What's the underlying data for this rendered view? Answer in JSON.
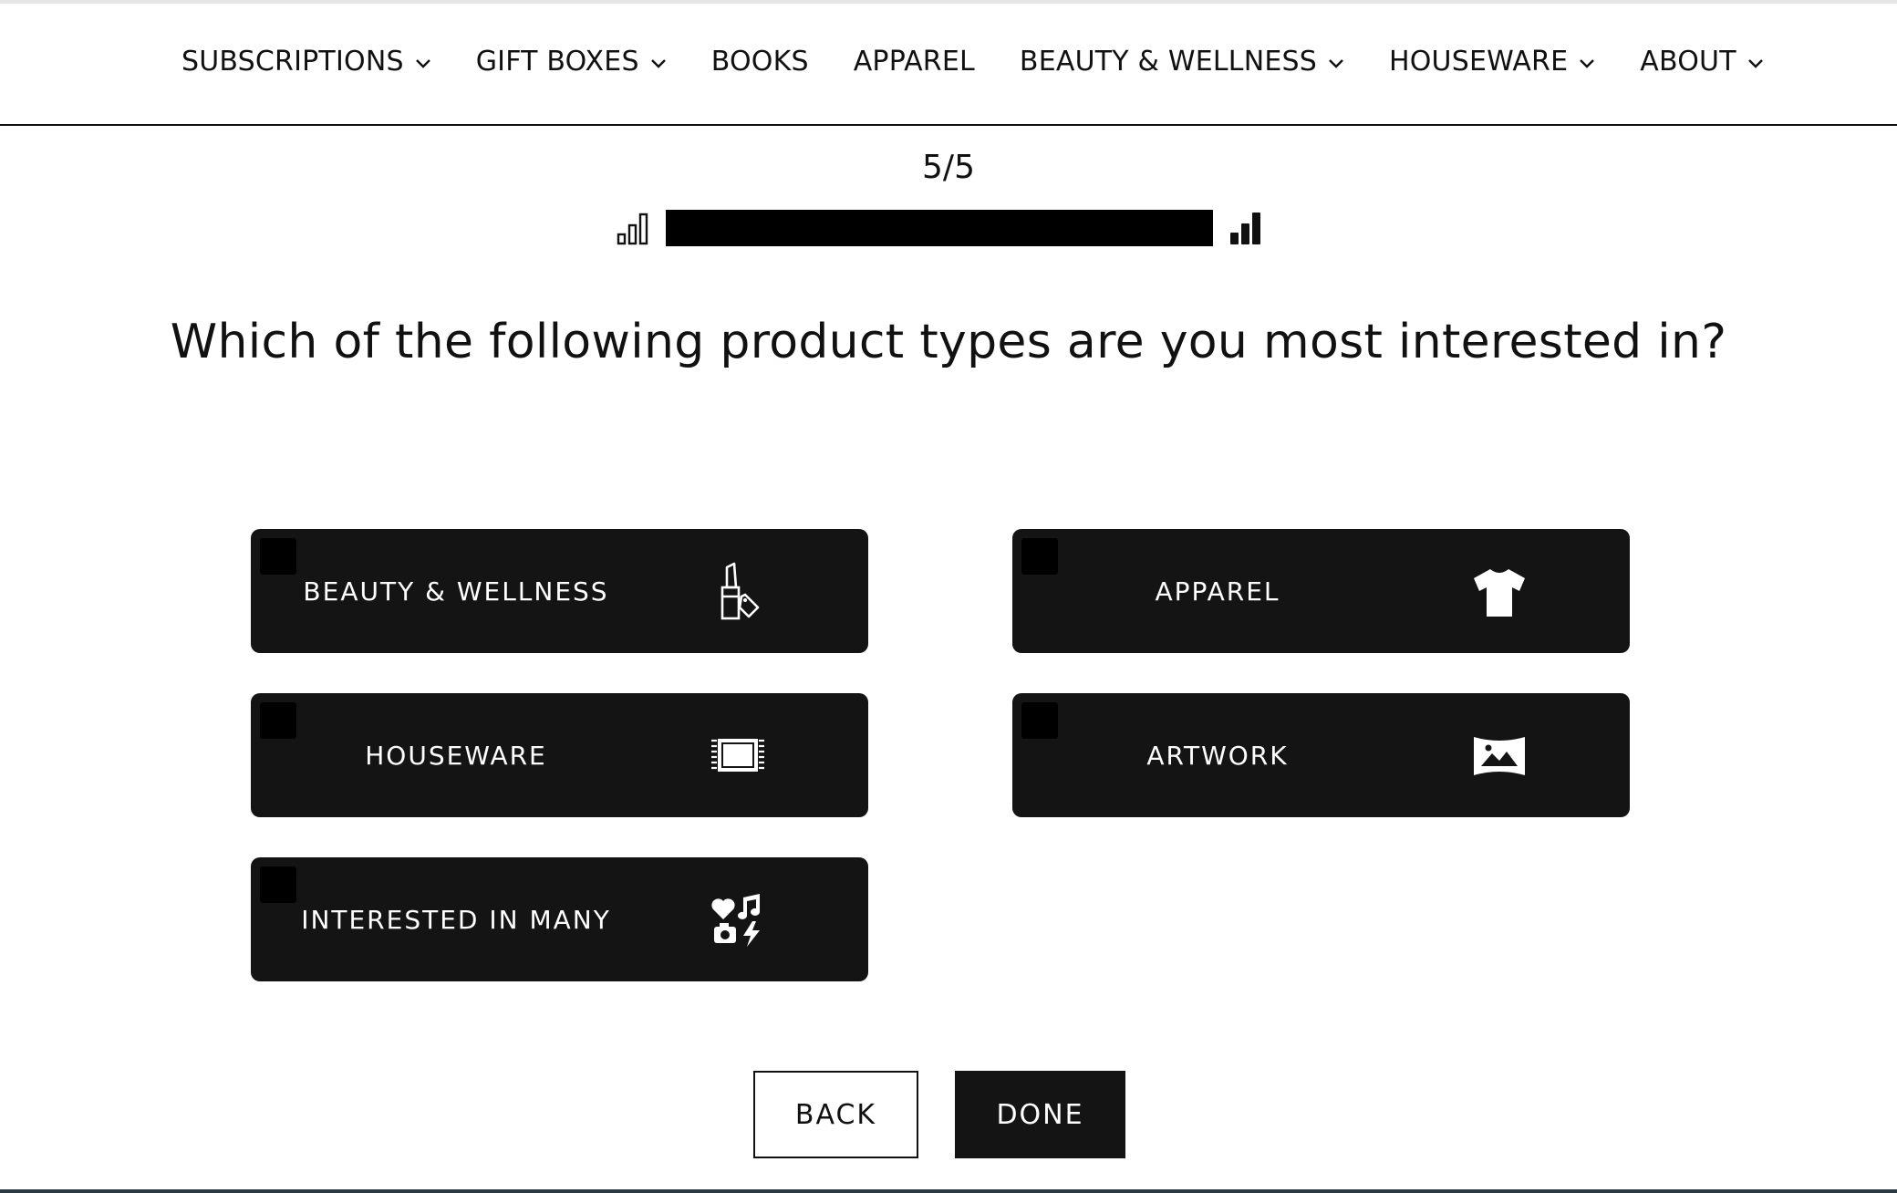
{
  "nav": {
    "items": [
      {
        "label": "SUBSCRIPTIONS",
        "has_dropdown": true
      },
      {
        "label": "GIFT BOXES",
        "has_dropdown": true
      },
      {
        "label": "BOOKS",
        "has_dropdown": false
      },
      {
        "label": "APPAREL",
        "has_dropdown": false
      },
      {
        "label": "BEAUTY & WELLNESS",
        "has_dropdown": true
      },
      {
        "label": "HOUSEWARE",
        "has_dropdown": true
      },
      {
        "label": "ABOUT",
        "has_dropdown": true
      }
    ]
  },
  "quiz": {
    "step": "5/5",
    "progress_fraction": 1.0,
    "question": "Which of the following product types are you most interested in?",
    "options": [
      {
        "label": "BEAUTY & WELLNESS",
        "icon": "lipstick-icon",
        "checked": false
      },
      {
        "label": "APPAREL",
        "icon": "tshirt-icon",
        "checked": false
      },
      {
        "label": "HOUSEWARE",
        "icon": "rug-icon",
        "checked": false
      },
      {
        "label": "ARTWORK",
        "icon": "landscape-image-icon",
        "checked": false
      },
      {
        "label": "INTERESTED IN MANY",
        "icon": "many-interests-icon",
        "checked": false
      }
    ]
  },
  "buttons": {
    "back": "BACK",
    "done": "DONE"
  },
  "colors": {
    "option_bg": "#141414",
    "text": "#111111",
    "progress_fill": "#000000",
    "background": "#ffffff"
  }
}
